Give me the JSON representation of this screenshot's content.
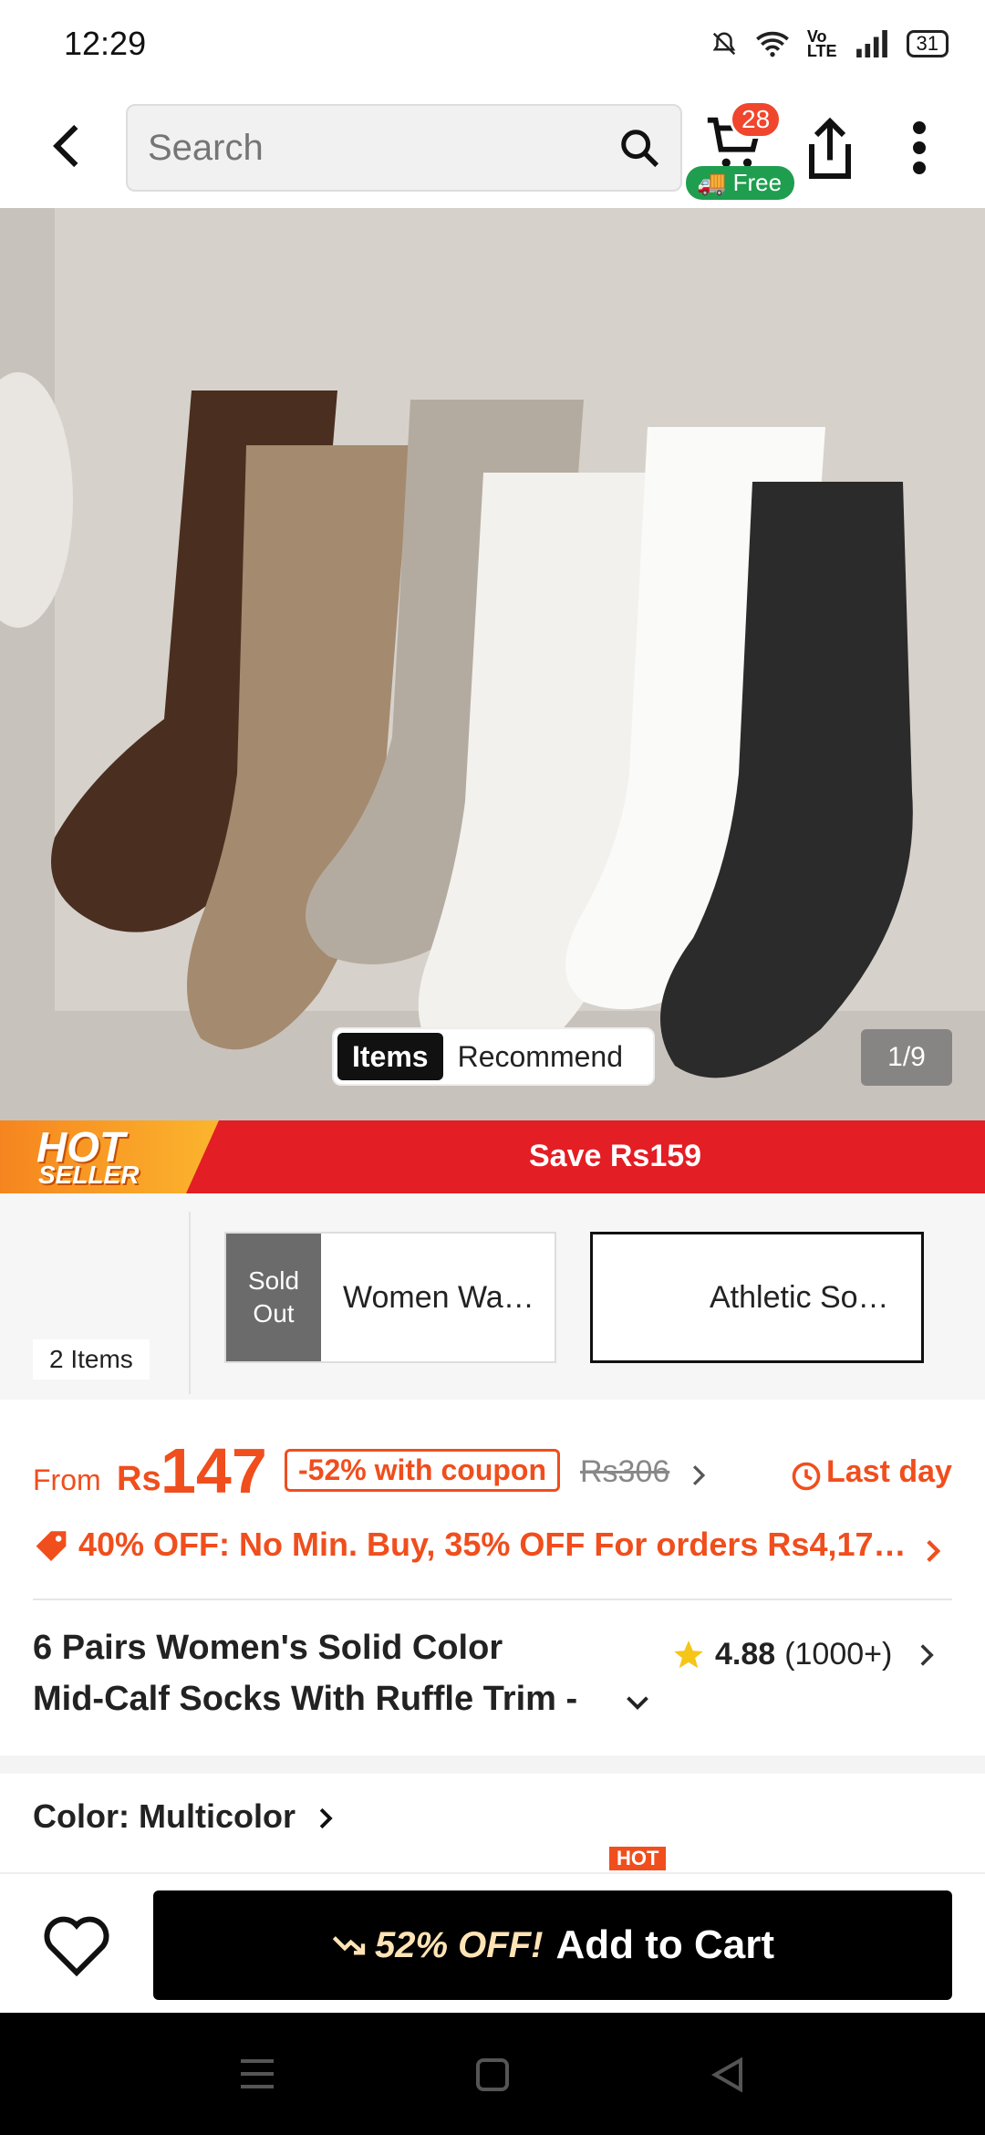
{
  "status_bar": {
    "time": "12:29",
    "battery": "31"
  },
  "nav": {
    "search_placeholder": "Search",
    "cart_count": "28",
    "free_label": "Free"
  },
  "gallery": {
    "tabs": [
      "Items",
      "Recommend"
    ],
    "counter": "1/9"
  },
  "promo": {
    "hot_top": "HOT",
    "hot_bottom": "SELLER",
    "save_text": "Save Rs159"
  },
  "bundle": {
    "count": "2 Items",
    "items": [
      {
        "badge": "Sold\nOut",
        "name": "Women Wa…"
      },
      {
        "name": "Athletic So…"
      }
    ]
  },
  "pricing": {
    "from": "From",
    "currency": "Rs",
    "price": "147",
    "coupon": "-52% with coupon",
    "old_price": "Rs306",
    "deadline": "Last day",
    "offers": "40% OFF: No Min. Buy,  35% OFF For orders Rs4,17…"
  },
  "product": {
    "title_line1": "6 Pairs Women's Solid Color",
    "title_line2": "Mid-Calf Socks With Ruffle Trim -",
    "rating": "4.88",
    "reviews": "(1000+)"
  },
  "color": {
    "label": "Color: Multicolor",
    "hot_tag": "HOT"
  },
  "actions": {
    "discount": "52% OFF!",
    "add_to_cart": "Add to Cart"
  },
  "colors": {
    "accent": "#f04e1d",
    "promo_red": "#e31e24",
    "hot_orange": "#f6851f",
    "free_green": "#1f9e4f",
    "star": "#f5c518"
  }
}
